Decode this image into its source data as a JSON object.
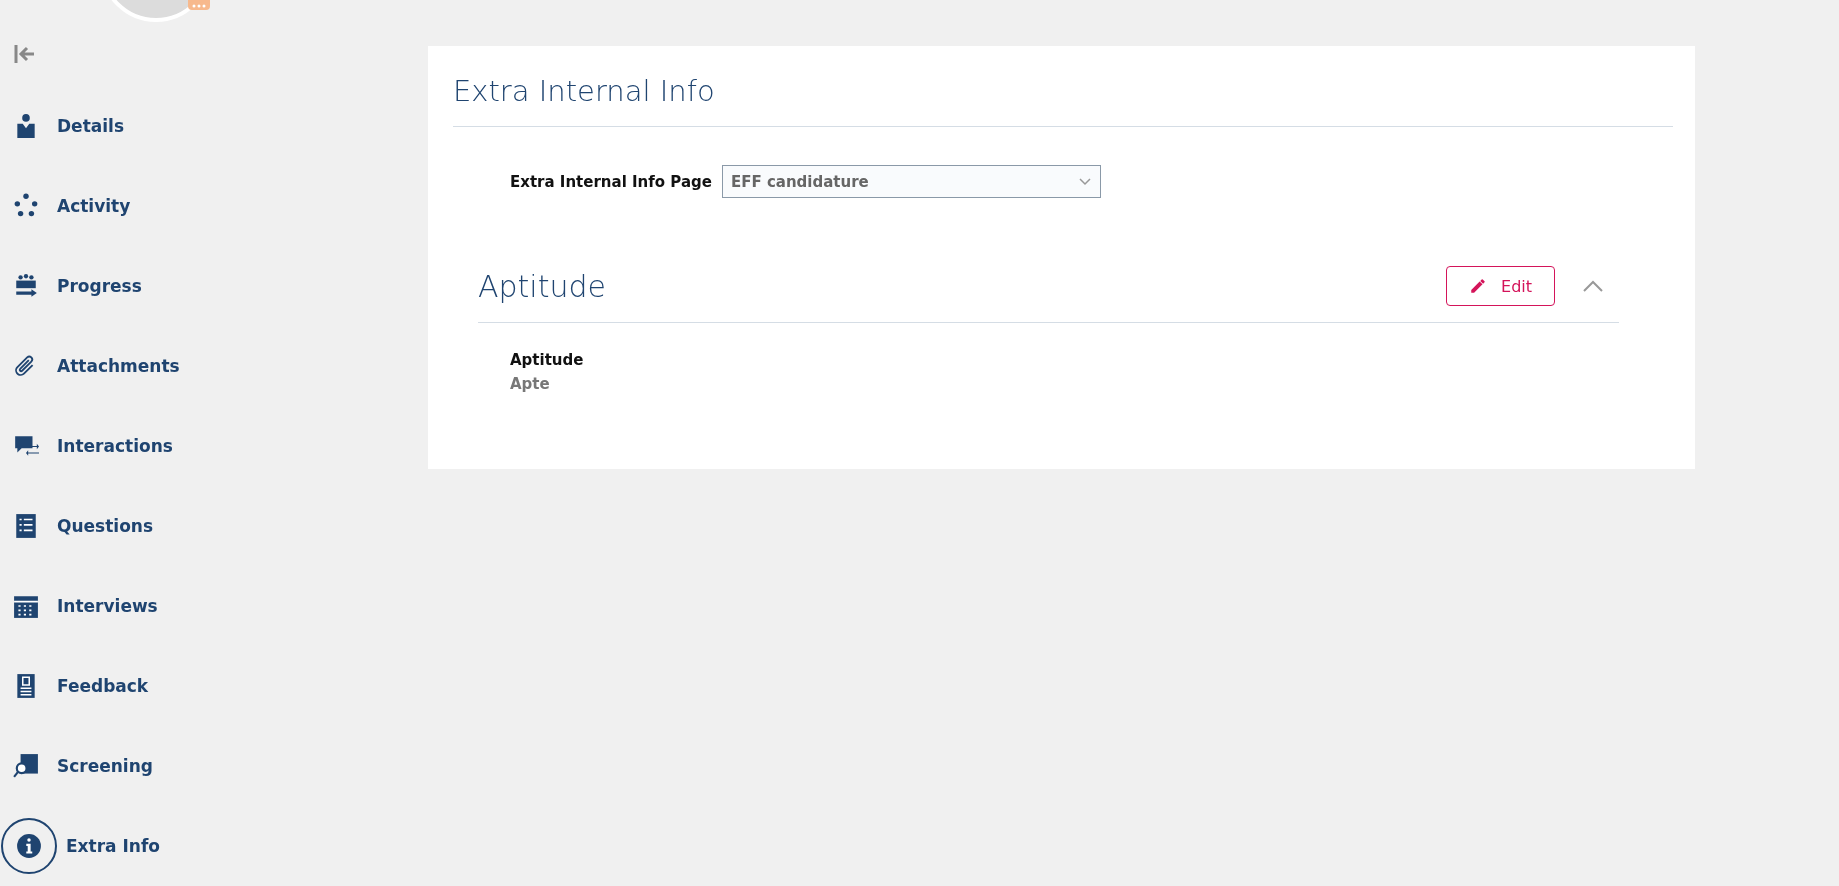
{
  "sidebar": {
    "items": [
      {
        "label": "Details",
        "kind": "person",
        "selected": false
      },
      {
        "label": "Activity",
        "kind": "cycle",
        "selected": false
      },
      {
        "label": "Progress",
        "kind": "progress",
        "selected": false
      },
      {
        "label": "Attachments",
        "kind": "clip",
        "selected": false
      },
      {
        "label": "Interactions",
        "kind": "chat",
        "selected": false
      },
      {
        "label": "Questions",
        "kind": "list",
        "selected": false
      },
      {
        "label": "Interviews",
        "kind": "calendar",
        "selected": false
      },
      {
        "label": "Feedback",
        "kind": "badge",
        "selected": false
      },
      {
        "label": "Screening",
        "kind": "screen",
        "selected": false
      },
      {
        "label": "Extra Info",
        "kind": "info",
        "selected": true
      }
    ]
  },
  "card": {
    "title": "Extra Internal Info",
    "page_field": {
      "label": "Extra Internal Info Page",
      "value": "EFF candidature"
    },
    "section": {
      "title": "Aptitude",
      "edit_label": "Edit",
      "expanded": true,
      "fields": [
        {
          "label": "Aptitude",
          "value": "Apte"
        }
      ]
    }
  }
}
